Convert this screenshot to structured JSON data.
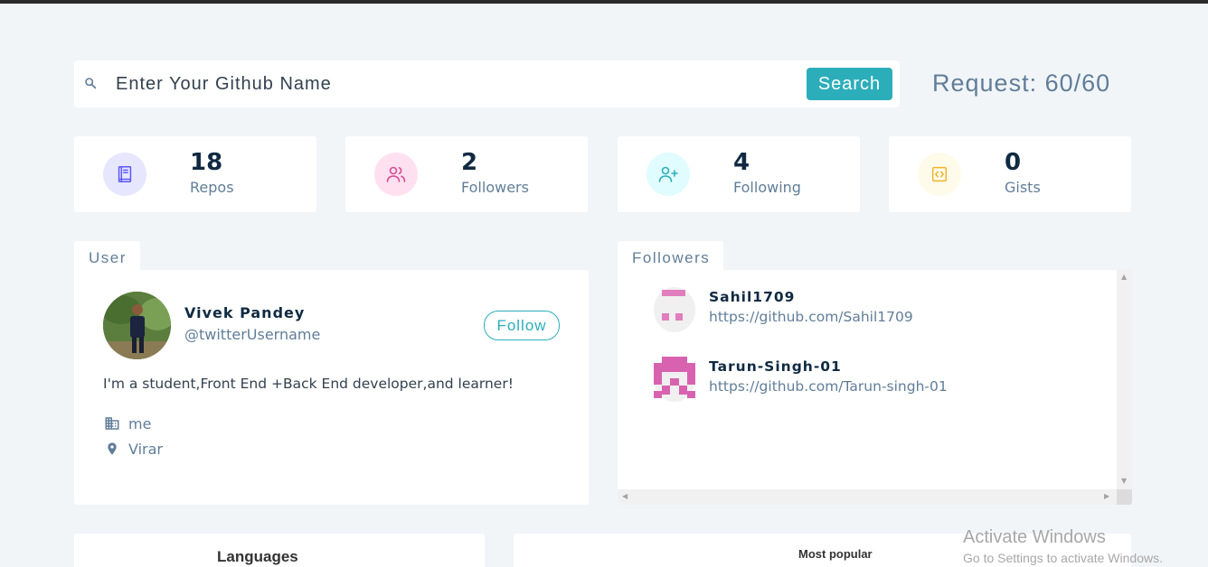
{
  "search": {
    "placeholder": "Enter Your Github Name",
    "button_label": "Search",
    "icon": "search-icon"
  },
  "request_status": "Request: 60/60",
  "stats": [
    {
      "value": "18",
      "label": "Repos",
      "icon": "book-icon",
      "color": "#5d55fa",
      "bg": "#e6e6ff"
    },
    {
      "value": "2",
      "label": "Followers",
      "icon": "users-icon",
      "color": "#da4a91",
      "bg": "#ffe0f0"
    },
    {
      "value": "4",
      "label": "Following",
      "icon": "user-plus-icon",
      "color": "#2caeba",
      "bg": "#e0fcff"
    },
    {
      "value": "0",
      "label": "Gists",
      "icon": "code-icon",
      "color": "#f0b429",
      "bg": "#fffbea"
    }
  ],
  "user_panel": {
    "tab": "User",
    "name": "Vivek Pandey",
    "handle": "@twitterUsername",
    "follow_label": "Follow",
    "bio": "I'm a student,Front End +Back End developer,and learner!",
    "company": "me",
    "location": "Virar"
  },
  "followers_panel": {
    "tab": "Followers",
    "items": [
      {
        "login": "Sahil1709",
        "url": "https://github.com/Sahil1709"
      },
      {
        "login": "Tarun-Singh-01",
        "url": "https://github.com/Tarun-singh-01"
      }
    ]
  },
  "bottom": {
    "languages_title": "Languages",
    "popular_title": "Most popular"
  },
  "watermark": {
    "line1": "Activate Windows",
    "line2": "Go to Settings to activate Windows."
  },
  "colors": {
    "accent": "#2caeba",
    "background": "#f1f5f8",
    "muted_text": "#617d98",
    "identicon_pink": "#d862b0"
  }
}
